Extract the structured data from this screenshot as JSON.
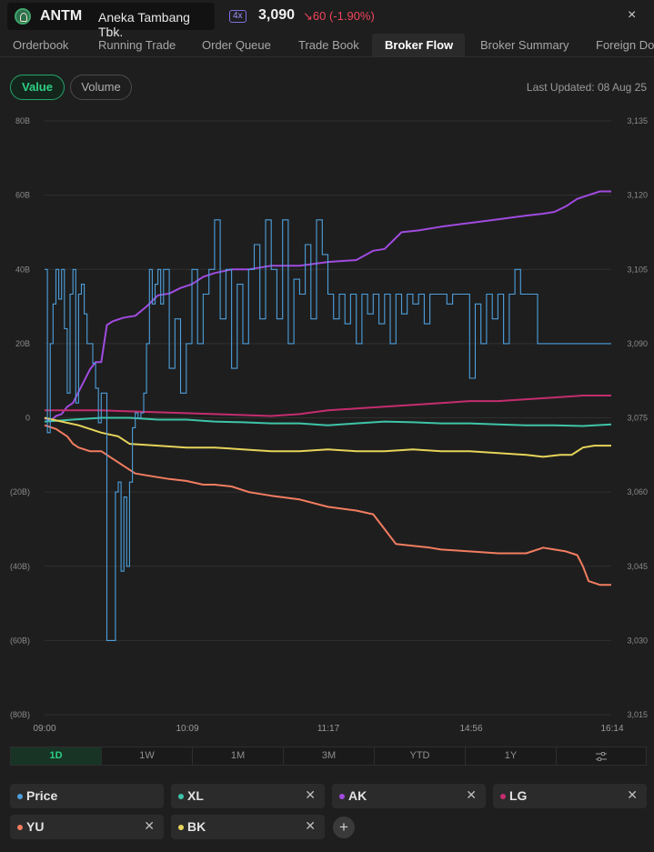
{
  "header": {
    "symbol": "ANTM",
    "company": "Aneka Tambang Tbk.",
    "badge": "4x",
    "price": "3,090",
    "change": "↘60 (-1.90%)",
    "close": "×"
  },
  "tabs": [
    "Orderbook",
    "Running Trade",
    "Order Queue",
    "Trade Book",
    "Broker Flow",
    "Broker Summary",
    "Foreign Dom"
  ],
  "active_tab": "Broker Flow",
  "toggles": {
    "value": "Value",
    "volume": "Volume"
  },
  "last_updated": "Last Updated: 08 Aug 25",
  "periods": [
    "1D",
    "1W",
    "1M",
    "3M",
    "YTD",
    "1Y"
  ],
  "active_period": "1D",
  "chips": [
    {
      "label": "Price",
      "color": "#4d9fdc",
      "removable": false
    },
    {
      "label": "XL",
      "color": "#3ec4a9",
      "removable": true
    },
    {
      "label": "AK",
      "color": "#a14be0",
      "removable": true
    },
    {
      "label": "LG",
      "color": "#c42d6e",
      "removable": true
    },
    {
      "label": "YU",
      "color": "#f27d60",
      "removable": true
    },
    {
      "label": "BK",
      "color": "#e6d45a",
      "removable": true
    }
  ],
  "add_label": "+",
  "chart_data": {
    "type": "line",
    "x_ticks": [
      "09:00",
      "10:09",
      "11:17",
      "14:56",
      "16:14"
    ],
    "y_left_ticks": [
      "80B",
      "60B",
      "40B",
      "20B",
      "0",
      "(20B)",
      "(40B)",
      "(60B)",
      "(80B)"
    ],
    "y_right_ticks": [
      "3,135",
      "3,120",
      "3,105",
      "3,090",
      "3,075",
      "3,060",
      "3,045",
      "3,030",
      "3,015"
    ],
    "ylim_left": [
      -80,
      80
    ],
    "ylim_right": [
      3015,
      3135
    ],
    "x_range": [
      0,
      100
    ],
    "grid": true,
    "price_series": {
      "name": "Price",
      "color": "#4d9fdc",
      "x": [
        0,
        0.5,
        1,
        1.5,
        2,
        2.5,
        3,
        3.5,
        4,
        4.5,
        5,
        5.5,
        6,
        6.5,
        7,
        7.5,
        8,
        8.5,
        9,
        9.5,
        10,
        11,
        11.5,
        12,
        12.5,
        13,
        13.5,
        14,
        14.5,
        15,
        15.5,
        16,
        16.5,
        17,
        17.5,
        18,
        18.5,
        19,
        19.5,
        20,
        20.5,
        21,
        22,
        23,
        24,
        25,
        26,
        27,
        28,
        29,
        30,
        31,
        32,
        33,
        34,
        35,
        36,
        37,
        38,
        39,
        40,
        41,
        42,
        43,
        44,
        45,
        46,
        47,
        48,
        49,
        50,
        51,
        52,
        53,
        54,
        55,
        56,
        57,
        58,
        59,
        60,
        61,
        62,
        63,
        64,
        65,
        66,
        67,
        68,
        69,
        70,
        71,
        72,
        73,
        74,
        75,
        76,
        77,
        78,
        79,
        80,
        81,
        82,
        83,
        84,
        85,
        86,
        87,
        88,
        89,
        90,
        91,
        92,
        93,
        94,
        95,
        96,
        97,
        98,
        99,
        100
      ],
      "values": [
        3105,
        3072,
        3090,
        3098,
        3105,
        3099,
        3105,
        3093,
        3080,
        3100,
        3105,
        3078,
        3100,
        3102,
        3096,
        3090,
        3090,
        3086,
        3081,
        3074,
        3080,
        3030,
        3030,
        3030,
        3060,
        3062,
        3044,
        3059,
        3045,
        3062,
        3073,
        3076,
        3075,
        3076,
        3080,
        3090,
        3105,
        3098,
        3102,
        3105,
        3098,
        3105,
        3085,
        3095,
        3080,
        3090,
        3105,
        3090,
        3100,
        3105,
        3115,
        3095,
        3105,
        3085,
        3102,
        3090,
        3105,
        3110,
        3095,
        3115,
        3105,
        3095,
        3115,
        3090,
        3103,
        3100,
        3110,
        3095,
        3115,
        3108,
        3100,
        3095,
        3100,
        3094,
        3100,
        3090,
        3100,
        3096,
        3100,
        3094,
        3100,
        3090,
        3100,
        3096,
        3100,
        3098,
        3100,
        3094,
        3100,
        3100,
        3100,
        3098,
        3100,
        3100,
        3100,
        3083,
        3098,
        3090,
        3100,
        3095,
        3100,
        3090,
        3100,
        3105,
        3100,
        3100,
        3100,
        3090,
        3090,
        3090,
        3090,
        3090,
        3090,
        3090,
        3090,
        3090,
        3090,
        3090,
        3090,
        3090,
        3090
      ]
    },
    "series": [
      {
        "name": "AK",
        "color": "#a14be0",
        "x": [
          0,
          1,
          2,
          3,
          4,
          5,
          6,
          7,
          8,
          9,
          10,
          11,
          12,
          13,
          14,
          16,
          18,
          20,
          22,
          24,
          26,
          28,
          30,
          33,
          36,
          40,
          45,
          50,
          55,
          58,
          60,
          63,
          66,
          70,
          75,
          80,
          85,
          88,
          90,
          92,
          94,
          96,
          98,
          100
        ],
        "values": [
          0,
          -1,
          0.5,
          1,
          3,
          4,
          7,
          10,
          13,
          15,
          15,
          25,
          26,
          26.5,
          27,
          27.5,
          30,
          33,
          33.5,
          35,
          36,
          38,
          39,
          40,
          40,
          41,
          41,
          42,
          42.5,
          45,
          45.5,
          50,
          50.5,
          51.5,
          52.5,
          53.5,
          54.5,
          55,
          55.5,
          57,
          59,
          60,
          61,
          61
        ]
      },
      {
        "name": "LG",
        "color": "#c42d6e",
        "x": [
          0,
          10,
          20,
          30,
          40,
          45,
          50,
          55,
          60,
          65,
          70,
          75,
          80,
          85,
          90,
          95,
          100
        ],
        "values": [
          2,
          2,
          1.5,
          1,
          0.5,
          1,
          2,
          2.5,
          3,
          3.5,
          4,
          4.5,
          4.5,
          5,
          5.5,
          6,
          6
        ]
      },
      {
        "name": "XL",
        "color": "#3ec4a9",
        "x": [
          0,
          5,
          10,
          15,
          20,
          25,
          30,
          35,
          40,
          45,
          50,
          55,
          60,
          65,
          70,
          75,
          80,
          85,
          90,
          95,
          100
        ],
        "values": [
          -1,
          -0.5,
          0,
          0,
          -0.5,
          -0.5,
          -1,
          -1.2,
          -1.5,
          -1.5,
          -2,
          -1.5,
          -1,
          -1.2,
          -1.5,
          -1.5,
          -1.8,
          -2,
          -2,
          -2.2,
          -1.8
        ]
      },
      {
        "name": "BK",
        "color": "#e6d45a",
        "x": [
          0,
          3,
          6,
          10,
          13,
          15,
          20,
          25,
          30,
          35,
          40,
          45,
          50,
          55,
          60,
          65,
          70,
          75,
          80,
          85,
          88,
          91,
          93,
          95,
          97,
          100
        ],
        "values": [
          0,
          -1,
          -2,
          -4,
          -5,
          -7,
          -7.5,
          -8,
          -8,
          -8.5,
          -9,
          -9,
          -8.5,
          -9,
          -9,
          -8.5,
          -9,
          -9,
          -9.5,
          -10,
          -10.5,
          -10,
          -10,
          -8,
          -7.5,
          -7.5
        ]
      },
      {
        "name": "YU",
        "color": "#f27d60",
        "x": [
          0,
          2,
          4,
          5,
          6,
          8,
          10,
          12,
          14,
          16,
          18,
          20,
          22,
          25,
          28,
          30,
          33,
          36,
          40,
          45,
          50,
          55,
          58,
          60,
          62,
          65,
          68,
          70,
          75,
          80,
          85,
          88,
          90,
          92,
          94,
          95,
          96,
          98,
          100
        ],
        "values": [
          -2,
          -3,
          -5,
          -7,
          -8,
          -9,
          -9,
          -11,
          -13,
          -15,
          -15.5,
          -16,
          -16.5,
          -17,
          -18,
          -18,
          -18.5,
          -20,
          -21,
          -22,
          -24,
          -25,
          -26,
          -30,
          -34,
          -34.5,
          -35,
          -35.5,
          -36,
          -36.5,
          -36.5,
          -35,
          -35.5,
          -36,
          -37,
          -40,
          -44,
          -45,
          -45
        ]
      }
    ]
  }
}
